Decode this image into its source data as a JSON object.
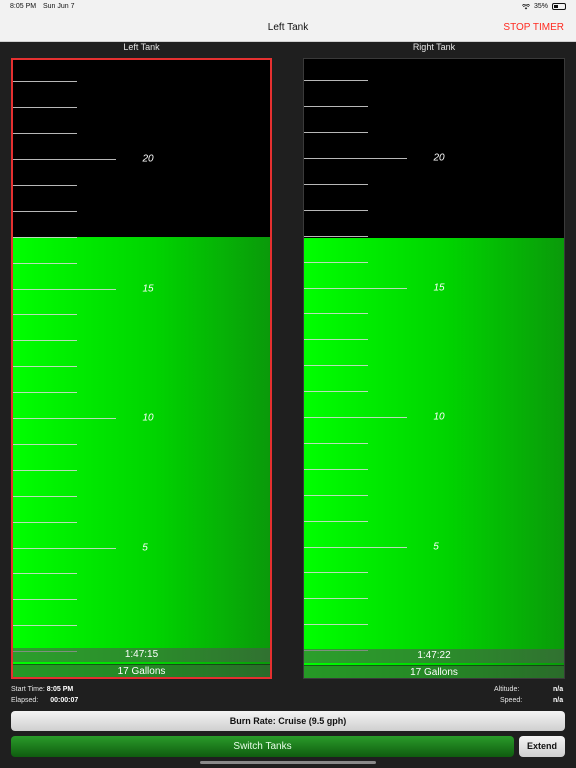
{
  "status_bar": {
    "time": "8:05 PM",
    "date": "Sun Jun 7",
    "battery": "35%",
    "battery_level": 0.35
  },
  "nav": {
    "title": "Left Tank",
    "stop_timer_label": "STOP TIMER"
  },
  "tanks": {
    "capacity_gallons": 24,
    "left": {
      "label": "Left Tank",
      "time": "1:47:15",
      "gallons_label": "17 Gallons",
      "fuel_gallons": 17,
      "selected": true
    },
    "right": {
      "label": "Right Tank",
      "time": "1:47:22",
      "gallons_label": "17 Gallons",
      "fuel_gallons": 17,
      "selected": false
    },
    "scale_labels": [
      "20",
      "15",
      "10",
      "5"
    ]
  },
  "info": {
    "start_time_label": "Start Time:",
    "start_time": "8:05 PM",
    "elapsed_label": "Elapsed:",
    "elapsed": "00:00:07",
    "altitude_label": "Altitude:",
    "altitude": "n/a",
    "speed_label": "Speed:",
    "speed": "n/a"
  },
  "controls": {
    "burn_rate_label": "Burn Rate: Cruise (9.5 gph)",
    "switch_tanks_label": "Switch Tanks",
    "extend_label": "Extend"
  },
  "colors": {
    "fuel_top": "#00ff00",
    "fuel_bottom": "#0a9a0a",
    "selected_border": "#e53030",
    "stop_timer": "#ff2a20"
  }
}
